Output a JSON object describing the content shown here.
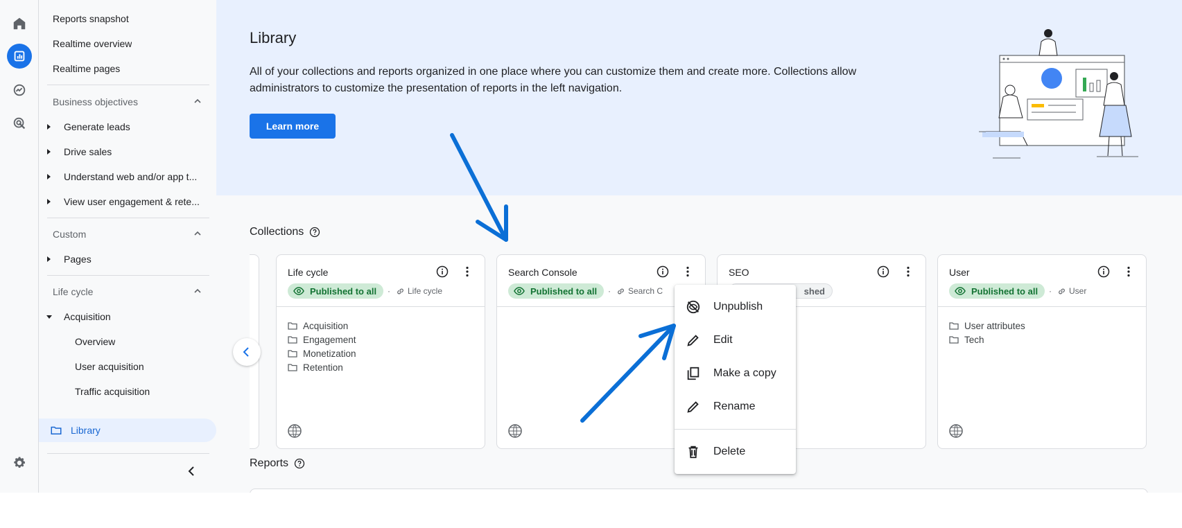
{
  "sidebar": {
    "top_items": [
      "Reports snapshot",
      "Realtime overview",
      "Realtime pages"
    ],
    "business_objectives": {
      "label": "Business objectives",
      "items": [
        "Generate leads",
        "Drive sales",
        "Understand web and/or app t...",
        "View user engagement & rete..."
      ]
    },
    "custom": {
      "label": "Custom",
      "items": [
        "Pages"
      ]
    },
    "life_cycle": {
      "label": "Life cycle",
      "acquisition": "Acquisition",
      "acquisition_items": [
        "Overview",
        "User acquisition",
        "Traffic acquisition"
      ]
    },
    "library": "Library"
  },
  "hero": {
    "title": "Library",
    "description": "All of your collections and reports organized in one place where you can customize them and create more. Collections allow administrators to customize the presentation of reports in the left navigation.",
    "button": "Learn more"
  },
  "collections": {
    "title": "Collections",
    "cards": [
      {
        "title": "Life cycle",
        "status": "Published to all",
        "linked": "Life cycle",
        "folders": [
          "Acquisition",
          "Engagement",
          "Monetization",
          "Retention"
        ]
      },
      {
        "title": "Search Console",
        "status": "Published to all",
        "linked": "Search C",
        "folders": []
      },
      {
        "title": "SEO",
        "status": "shed",
        "linked": "",
        "folders": []
      },
      {
        "title": "User",
        "status": "Published to all",
        "linked": "User",
        "folders": [
          "User attributes",
          "Tech"
        ]
      }
    ]
  },
  "reports": {
    "title": "Reports"
  },
  "context_menu": {
    "items": [
      "Unpublish",
      "Edit",
      "Make a copy",
      "Rename",
      "Delete"
    ]
  },
  "colors": {
    "accent": "#1a73e8",
    "hero_bg": "#e8f0fe",
    "published_bg": "#ceead6",
    "published_text": "#137333",
    "annotation_arrow": "#0b6fd6"
  }
}
